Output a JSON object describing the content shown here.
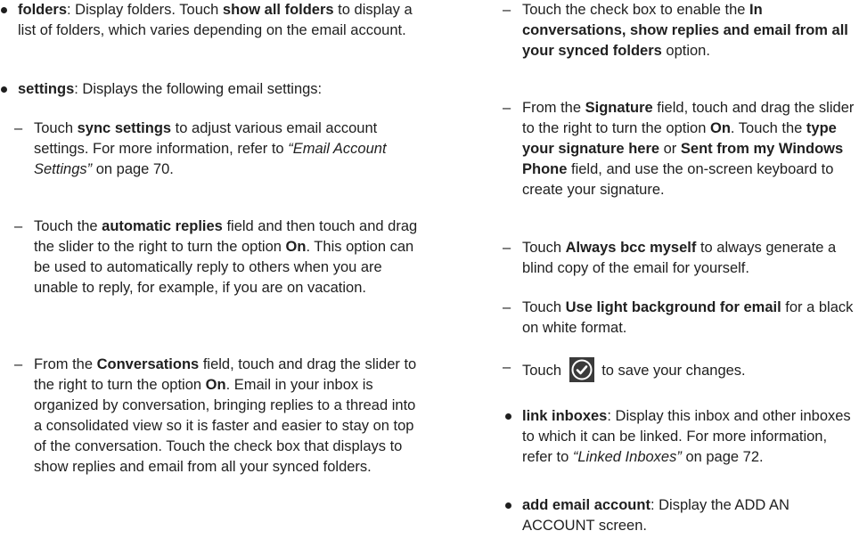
{
  "left": {
    "folders": {
      "term": "folders",
      "t1": ": Display folders. Touch ",
      "action": "show all folders",
      "t2": " to display a list of folders, which varies depending on the email account."
    },
    "settings": {
      "term": "settings",
      "t1": ": Displays the following email settings:"
    },
    "sync": {
      "t1": "Touch ",
      "term": "sync settings",
      "t2": " to adjust various email account settings. For more information, refer to ",
      "link": "“Email Account Settings”",
      "t3": "  on page 70."
    },
    "auto": {
      "t1": "Touch the ",
      "term": "automatic replies",
      "t2": " field and then touch and drag the slider to the right to turn the option ",
      "on": "On",
      "t3": ". This option can be used to automatically reply to others when you are unable to reply, for example, if you are on vacation."
    },
    "conv": {
      "t1": "From the ",
      "term": "Conversations",
      "t2": " field, touch and drag the slider to the right to turn the option ",
      "on": "On",
      "t3": ". Email in your inbox is organized by conversation, bringing replies to a thread into a consolidated view so it is faster and easier to stay on top of the conversation. Touch the check box that displays to show replies and email from all your synced folders."
    }
  },
  "right": {
    "inconv": {
      "t1": "Touch the check box to enable the ",
      "term": "In conversations, show replies and email from all your synced folders",
      "t2": " option."
    },
    "sig": {
      "t1": "From the ",
      "term": "Signature",
      "t2": " field, touch and drag the slider to the right to turn the option ",
      "on": "On",
      "t3": ". Touch the ",
      "term2": "type your signature here",
      "t4": " or ",
      "term3": "Sent from my Windows Phone",
      "t5": " field, and use the on-screen keyboard to create your signature."
    },
    "bcc": {
      "t1": "Touch ",
      "term": "Always bcc myself",
      "t2": " to always generate a blind copy of the email for yourself."
    },
    "light": {
      "t1": "Touch ",
      "term": "Use light background for email",
      "t2": " for a black on white format."
    },
    "save": {
      "t1": "Touch ",
      "icon": "check-circle-icon",
      "t2": " to save your changes."
    },
    "link": {
      "term": "link inboxes",
      "t1": ": Display this inbox and other inboxes to which it can be linked. For more information, refer to ",
      "ref": "“Linked Inboxes”",
      "t2": "  on page 72."
    },
    "add": {
      "term": "add email account",
      "t1": ": Display the ADD AN ACCOUNT screen."
    }
  },
  "dash": "–"
}
